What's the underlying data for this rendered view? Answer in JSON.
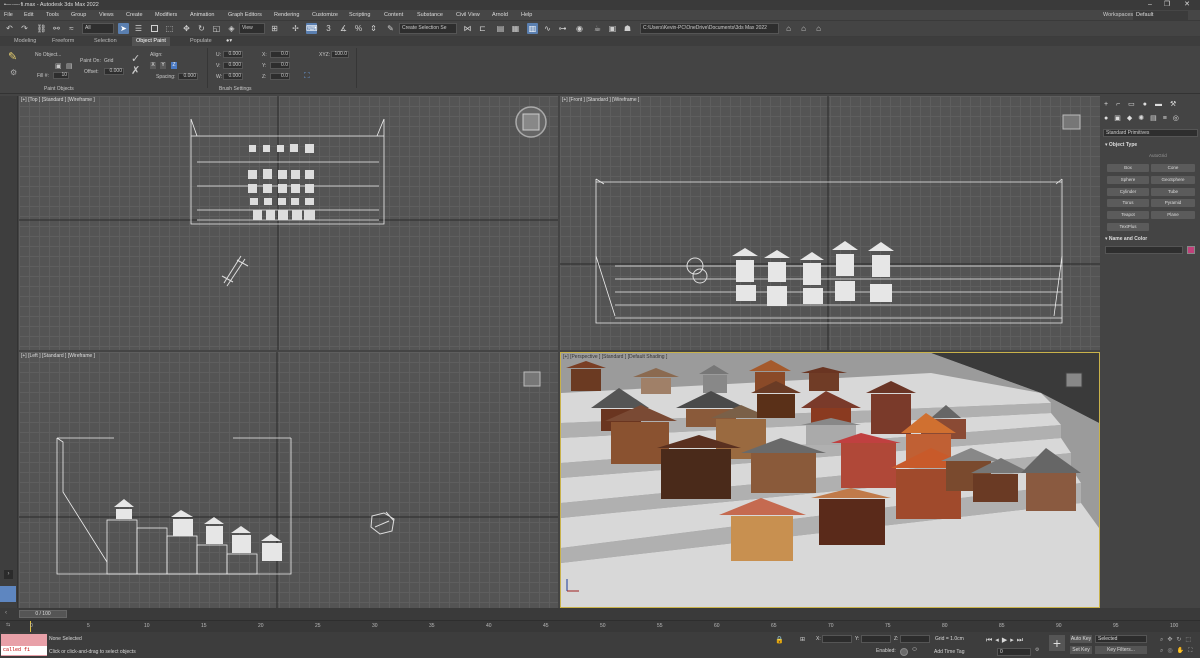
{
  "window": {
    "title": "•—·—·fi.max - Autodesk 3ds Max 2022",
    "minimize": "–",
    "maximize": "❐",
    "close": "✕"
  },
  "menu": [
    "File",
    "Edit",
    "Tools",
    "Group",
    "Views",
    "Create",
    "Modifiers",
    "Animation",
    "Graph Editors",
    "Rendering",
    "Customize",
    "Scripting",
    "Content",
    "Substance",
    "Civil View",
    "Arnold",
    "Help"
  ],
  "workspace": {
    "label": "Workspaces:",
    "value": "Default"
  },
  "toolbar": {
    "filter": "All",
    "ref_coord": "View",
    "selection_set": "Create Selection Se",
    "path": "C:\\Users\\Kevin-PC\\OneDrive\\Documents\\3ds Max 2022"
  },
  "ribbon_tabs": [
    "Modeling",
    "Freeform",
    "Selection",
    "Object Paint",
    "Populate"
  ],
  "ribbon_active": "Object Paint",
  "object_paint": {
    "no_object": "No Object...",
    "fill_label": "Fill #:",
    "fill_value": "10",
    "paint_on": "Paint On:",
    "paint_on_value": "Grid",
    "offset_label": "Offset:",
    "offset_value": "0.000",
    "group_label": "Paint Objects",
    "align": "Align:",
    "axis_x": "X",
    "axis_y": "Y",
    "axis_z": "Z",
    "spacing_label": "Spacing:",
    "spacing_value": "0.000",
    "u_label": "U:",
    "u_value": "0.000",
    "v_label": "V:",
    "v_value": "0.000",
    "w_label": "W:",
    "w_value": "0.000",
    "x_label": "X:",
    "x_value": "0.0",
    "y_label": "Y:",
    "y_value": "0.0",
    "z_label": "Z:",
    "z_value": "0.0",
    "xyz_label": "XYZ:",
    "xyz_value": "100.0",
    "brush_group": "Brush Settings"
  },
  "viewports": {
    "top": "[+] [Top ] [Standard ] [Wireframe ]",
    "front": "[+] [Front ] [Standard ] [Wireframe ]",
    "left": "[+] [Left ] [Standard ] [Wireframe ]",
    "persp": "[+] [Perspective ] [Standard ] [Default Shading ]"
  },
  "command_panel": {
    "dropdown": "Standard Primitives",
    "rollout_object_type": "Object Type",
    "autogrid": "AutoGrid",
    "buttons": [
      "Box",
      "Cone",
      "Sphere",
      "GeoSphere",
      "Cylinder",
      "Tube",
      "Torus",
      "Pyramid",
      "Teapot",
      "Plane",
      "TextPlus"
    ],
    "rollout_name_color": "Name and Color",
    "swatch_color": "#c0407a"
  },
  "timeline": {
    "frame": "0 / 100",
    "ticks": [
      "0",
      "5",
      "10",
      "15",
      "20",
      "25",
      "30",
      "35",
      "40",
      "45",
      "50",
      "55",
      "60",
      "65",
      "70",
      "75",
      "80",
      "85",
      "90",
      "95",
      "100"
    ]
  },
  "status": {
    "script": "called fi",
    "selection": "None Selected",
    "prompt": "Click or click-and-drag to select objects",
    "x_label": "X:",
    "y_label": "Y:",
    "z_label": "Z:",
    "grid": "Grid = 1.0cm",
    "enabled": "Enabled:",
    "add_time_tag": "Add Time Tag",
    "auto_key": "Auto Key",
    "set_key": "Set Key",
    "key_mode_value": "Selected",
    "key_filters": "Key Filters...",
    "frame_value": "0"
  }
}
